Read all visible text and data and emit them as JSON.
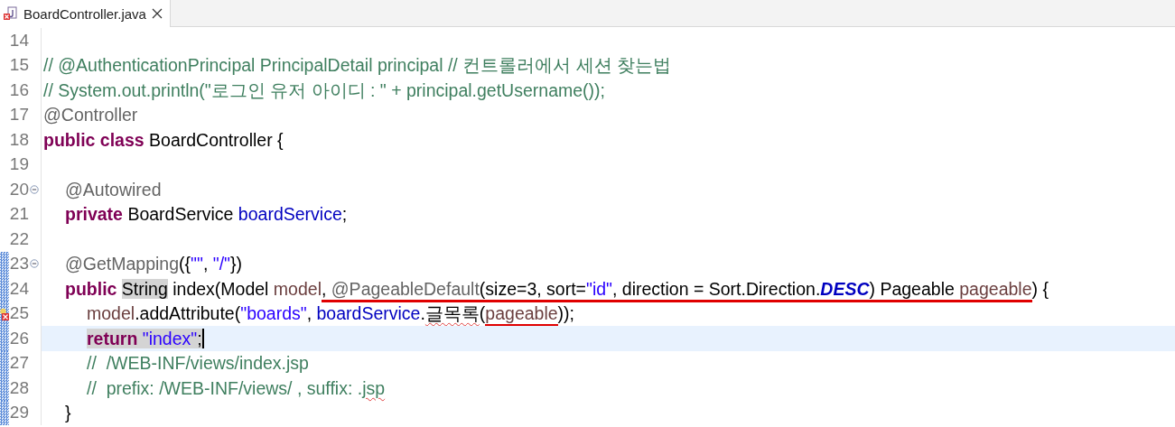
{
  "tab": {
    "title": "BoardController.java",
    "selected": true,
    "error": true
  },
  "lines": [
    {
      "number": "14",
      "fold": false,
      "error": false,
      "current": false,
      "changed": false
    },
    {
      "number": "15",
      "fold": false,
      "error": false,
      "current": false,
      "changed": false,
      "tokens": [
        {
          "text": "// @AuthenticationPrincipal PrincipalDetail principal // 컨트롤러에서 세션 찾는법",
          "kind": "comment"
        }
      ]
    },
    {
      "number": "16",
      "fold": false,
      "error": false,
      "current": false,
      "changed": false,
      "tokens": [
        {
          "text": "// System.out.println(\"로그인 유저 아이디 : \" + principal.getUsername());",
          "kind": "comment"
        }
      ]
    },
    {
      "number": "17",
      "fold": false,
      "error": false,
      "current": false,
      "changed": false,
      "tokens": [
        {
          "text": "@Controller",
          "kind": "annotation"
        }
      ]
    },
    {
      "number": "18",
      "fold": false,
      "error": false,
      "current": false,
      "changed": false,
      "tokens": [
        {
          "text": "public class",
          "kind": "keyword"
        },
        {
          "text": " BoardController {",
          "kind": "plain"
        }
      ]
    },
    {
      "number": "19",
      "fold": false,
      "error": false,
      "current": false,
      "changed": false
    },
    {
      "number": "20",
      "fold": true,
      "error": false,
      "current": false,
      "changed": false,
      "tokens": [
        {
          "text": "\t@Autowired",
          "kind": "annotation"
        }
      ]
    },
    {
      "number": "21",
      "fold": false,
      "error": false,
      "current": false,
      "changed": false,
      "tokens": [
        {
          "text": "\tprivate",
          "kind": "keyword"
        },
        {
          "text": " BoardService ",
          "kind": "plain"
        },
        {
          "text": "boardService",
          "kind": "field"
        },
        {
          "text": ";",
          "kind": "plain"
        }
      ]
    },
    {
      "number": "22",
      "fold": false,
      "error": false,
      "current": false,
      "changed": false
    },
    {
      "number": "23",
      "fold": true,
      "error": false,
      "current": false,
      "changed": true,
      "tokens": [
        {
          "text": "\t@GetMapping",
          "kind": "annotation"
        },
        {
          "text": "({",
          "kind": "plain"
        },
        {
          "text": "\"\"",
          "kind": "string"
        },
        {
          "text": ", ",
          "kind": "plain"
        },
        {
          "text": "\"/\"",
          "kind": "string"
        },
        {
          "text": "})",
          "kind": "plain"
        }
      ]
    },
    {
      "number": "24",
      "fold": false,
      "error": false,
      "current": false,
      "changed": true,
      "tokens": [
        {
          "text": "\tpublic ",
          "kind": "keyword"
        },
        {
          "text": "String",
          "kind": "plain",
          "marked": true
        },
        {
          "text": " index(Model ",
          "kind": "plain"
        },
        {
          "text": "model",
          "kind": "param"
        },
        {
          "text": ", ",
          "kind": "plain",
          "underlined": true
        },
        {
          "text": "@PageableDefault",
          "kind": "annotation",
          "underlined": true
        },
        {
          "text": "(size=3, sort=",
          "kind": "plain",
          "underlined": true
        },
        {
          "text": "\"id\"",
          "kind": "string",
          "underlined": true
        },
        {
          "text": ", direction = Sort.Direction.",
          "kind": "plain",
          "underlined": true
        },
        {
          "text": "DESC",
          "kind": "constant",
          "underlined": true
        },
        {
          "text": ") Pageable ",
          "kind": "plain",
          "underlined": true
        },
        {
          "text": "pageable",
          "kind": "param",
          "underlined": true
        },
        {
          "text": ") {",
          "kind": "plain"
        }
      ]
    },
    {
      "number": "25",
      "fold": false,
      "error": true,
      "current": false,
      "changed": true,
      "tokens": [
        {
          "text": "\t\tmodel",
          "kind": "param"
        },
        {
          "text": ".addAttribute(",
          "kind": "plain"
        },
        {
          "text": "\"boards\"",
          "kind": "string"
        },
        {
          "text": ", ",
          "kind": "plain"
        },
        {
          "text": "boardService",
          "kind": "field"
        },
        {
          "text": ".",
          "kind": "plain"
        },
        {
          "text": "글목록",
          "kind": "plain",
          "squiggle": true
        },
        {
          "text": "(",
          "kind": "plain"
        },
        {
          "text": "pageable",
          "kind": "param",
          "underlined": true
        },
        {
          "text": "));",
          "kind": "plain"
        }
      ]
    },
    {
      "number": "26",
      "fold": false,
      "error": false,
      "current": true,
      "changed": true,
      "tokens": [
        {
          "text": "\t\treturn ",
          "kind": "keyword",
          "marked": true
        },
        {
          "text": "\"index\"",
          "kind": "string",
          "marked": true
        },
        {
          "text": ";",
          "kind": "plain",
          "marked": true
        }
      ]
    },
    {
      "number": "27",
      "fold": false,
      "error": false,
      "current": false,
      "changed": true,
      "tokens": [
        {
          "text": "\t\t//  /WEB-INF/views/index.jsp",
          "kind": "comment"
        }
      ]
    },
    {
      "number": "28",
      "fold": false,
      "error": false,
      "current": false,
      "changed": true,
      "tokens": [
        {
          "text": "\t\t//  prefix: /WEB-INF/views/ , suffix: .",
          "kind": "comment"
        },
        {
          "text": "jsp",
          "kind": "comment",
          "squiggle": true
        }
      ]
    },
    {
      "number": "29",
      "fold": false,
      "error": false,
      "current": false,
      "changed": true,
      "tokens": [
        {
          "text": "\t}",
          "kind": "plain"
        }
      ]
    }
  ]
}
